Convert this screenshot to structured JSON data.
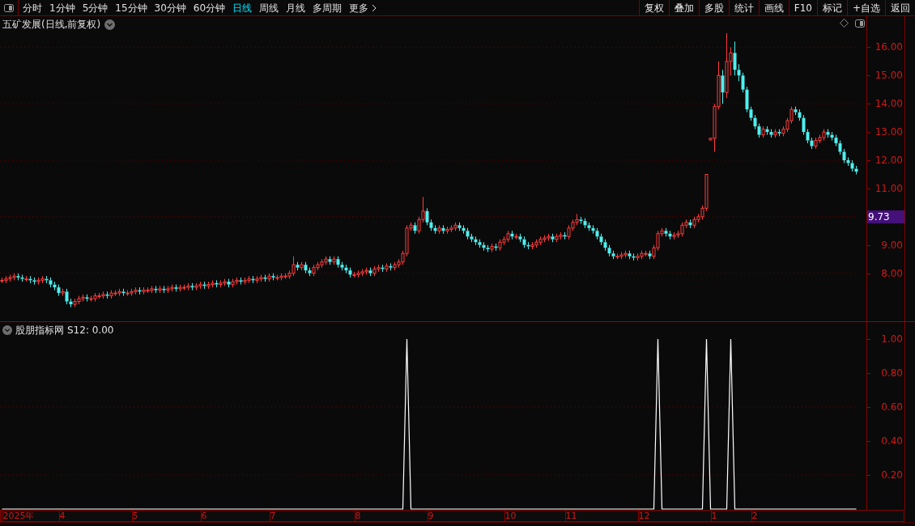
{
  "toolbar": {
    "periods": [
      {
        "label": "分时",
        "selected": false
      },
      {
        "label": "1分钟",
        "selected": false
      },
      {
        "label": "5分钟",
        "selected": false
      },
      {
        "label": "15分钟",
        "selected": false
      },
      {
        "label": "30分钟",
        "selected": false
      },
      {
        "label": "60分钟",
        "selected": false
      },
      {
        "label": "日线",
        "selected": true
      },
      {
        "label": "周线",
        "selected": false
      },
      {
        "label": "月线",
        "selected": false
      },
      {
        "label": "多周期",
        "selected": false
      },
      {
        "label": "更多",
        "selected": false
      }
    ],
    "buttons": [
      "复权",
      "叠加",
      "多股",
      "统计",
      "画线",
      "F10",
      "标记",
      "+自选",
      "返回"
    ]
  },
  "price_panel": {
    "title": "五矿发展(日线,前复权)",
    "chart_data": {
      "type": "candlestick",
      "ylim": [
        6.3,
        17.1
      ],
      "yticks": [
        {
          "value": 8,
          "label": "8.00"
        },
        {
          "value": 9,
          "label": "9.00"
        },
        {
          "value": 11,
          "label": "11.00"
        },
        {
          "value": 12,
          "label": "12.00"
        },
        {
          "value": 13,
          "label": "13.00"
        },
        {
          "value": 14,
          "label": "14.00"
        },
        {
          "value": 15,
          "label": "15.00"
        },
        {
          "value": 16,
          "label": "16.00"
        }
      ],
      "annotations": [
        "9.73"
      ],
      "grid": true,
      "ohlc": [
        [
          7.75,
          7.85,
          7.65,
          7.75
        ],
        [
          7.75,
          7.9,
          7.65,
          7.8
        ],
        [
          7.8,
          7.95,
          7.7,
          7.85
        ],
        [
          7.85,
          8.0,
          7.75,
          7.9
        ],
        [
          7.9,
          8.0,
          7.75,
          7.85
        ],
        [
          7.85,
          7.95,
          7.7,
          7.8
        ],
        [
          7.8,
          7.9,
          7.7,
          7.8
        ],
        [
          7.8,
          7.9,
          7.65,
          7.75
        ],
        [
          7.75,
          7.85,
          7.6,
          7.7
        ],
        [
          7.7,
          7.85,
          7.6,
          7.75
        ],
        [
          7.75,
          7.9,
          7.65,
          7.8
        ],
        [
          7.8,
          7.9,
          7.65,
          7.75
        ],
        [
          7.75,
          7.85,
          7.5,
          7.6
        ],
        [
          7.6,
          7.7,
          7.4,
          7.5
        ],
        [
          7.5,
          7.6,
          7.2,
          7.3
        ],
        [
          7.3,
          7.45,
          7.2,
          7.35
        ],
        [
          7.35,
          7.45,
          6.9,
          7.0
        ],
        [
          7.0,
          7.1,
          6.8,
          6.9
        ],
        [
          6.9,
          7.1,
          6.8,
          7.0
        ],
        [
          7.0,
          7.2,
          6.9,
          7.1
        ],
        [
          7.1,
          7.25,
          7.0,
          7.15
        ],
        [
          7.15,
          7.25,
          7.0,
          7.1
        ],
        [
          7.1,
          7.2,
          7.0,
          7.1
        ],
        [
          7.1,
          7.3,
          7.0,
          7.2
        ],
        [
          7.2,
          7.3,
          7.1,
          7.2
        ],
        [
          7.2,
          7.35,
          7.1,
          7.25
        ],
        [
          7.25,
          7.35,
          7.1,
          7.2
        ],
        [
          7.2,
          7.4,
          7.1,
          7.3
        ],
        [
          7.3,
          7.4,
          7.2,
          7.3
        ],
        [
          7.3,
          7.45,
          7.2,
          7.35
        ],
        [
          7.35,
          7.45,
          7.2,
          7.3
        ],
        [
          7.3,
          7.4,
          7.2,
          7.3
        ],
        [
          7.3,
          7.45,
          7.2,
          7.35
        ],
        [
          7.35,
          7.5,
          7.25,
          7.4
        ],
        [
          7.4,
          7.5,
          7.25,
          7.35
        ],
        [
          7.35,
          7.5,
          7.25,
          7.4
        ],
        [
          7.4,
          7.5,
          7.3,
          7.4
        ],
        [
          7.4,
          7.55,
          7.3,
          7.45
        ],
        [
          7.45,
          7.55,
          7.3,
          7.4
        ],
        [
          7.4,
          7.55,
          7.3,
          7.45
        ],
        [
          7.45,
          7.55,
          7.3,
          7.4
        ],
        [
          7.4,
          7.55,
          7.3,
          7.45
        ],
        [
          7.45,
          7.6,
          7.35,
          7.5
        ],
        [
          7.5,
          7.6,
          7.35,
          7.45
        ],
        [
          7.45,
          7.6,
          7.35,
          7.5
        ],
        [
          7.5,
          7.6,
          7.4,
          7.5
        ],
        [
          7.5,
          7.65,
          7.4,
          7.55
        ],
        [
          7.55,
          7.65,
          7.4,
          7.5
        ],
        [
          7.5,
          7.65,
          7.4,
          7.55
        ],
        [
          7.55,
          7.7,
          7.45,
          7.6
        ],
        [
          7.6,
          7.7,
          7.45,
          7.55
        ],
        [
          7.55,
          7.7,
          7.45,
          7.6
        ],
        [
          7.6,
          7.75,
          7.5,
          7.65
        ],
        [
          7.65,
          7.75,
          7.5,
          7.6
        ],
        [
          7.6,
          7.75,
          7.5,
          7.65
        ],
        [
          7.65,
          7.8,
          7.55,
          7.7
        ],
        [
          7.7,
          7.8,
          7.5,
          7.6
        ],
        [
          7.6,
          7.8,
          7.5,
          7.7
        ],
        [
          7.7,
          7.85,
          7.6,
          7.75
        ],
        [
          7.75,
          7.85,
          7.6,
          7.7
        ],
        [
          7.7,
          7.85,
          7.6,
          7.75
        ],
        [
          7.75,
          7.9,
          7.65,
          7.8
        ],
        [
          7.8,
          7.9,
          7.65,
          7.75
        ],
        [
          7.75,
          7.9,
          7.65,
          7.8
        ],
        [
          7.8,
          7.95,
          7.7,
          7.85
        ],
        [
          7.85,
          7.95,
          7.7,
          7.8
        ],
        [
          7.8,
          8.0,
          7.7,
          7.9
        ],
        [
          7.9,
          8.0,
          7.75,
          7.85
        ],
        [
          7.85,
          7.95,
          7.75,
          7.85
        ],
        [
          7.85,
          8.0,
          7.75,
          7.9
        ],
        [
          7.9,
          8.0,
          7.8,
          7.9
        ],
        [
          7.9,
          8.1,
          7.8,
          8.0
        ],
        [
          8.0,
          8.6,
          7.9,
          8.3
        ],
        [
          8.3,
          8.4,
          8.1,
          8.2
        ],
        [
          8.2,
          8.4,
          8.1,
          8.3
        ],
        [
          8.3,
          8.4,
          8.0,
          8.1
        ],
        [
          8.1,
          8.2,
          7.9,
          8.0
        ],
        [
          8.0,
          8.3,
          7.9,
          8.2
        ],
        [
          8.2,
          8.4,
          8.1,
          8.3
        ],
        [
          8.3,
          8.5,
          8.2,
          8.4
        ],
        [
          8.4,
          8.6,
          8.3,
          8.5
        ],
        [
          8.5,
          8.6,
          8.3,
          8.4
        ],
        [
          8.4,
          8.6,
          8.3,
          8.5
        ],
        [
          8.5,
          8.6,
          8.2,
          8.3
        ],
        [
          8.3,
          8.4,
          8.1,
          8.2
        ],
        [
          8.2,
          8.3,
          8.0,
          8.1
        ],
        [
          8.1,
          8.2,
          7.85,
          7.95
        ],
        [
          7.95,
          8.05,
          7.85,
          7.95
        ],
        [
          7.95,
          8.1,
          7.85,
          8.0
        ],
        [
          8.0,
          8.15,
          7.9,
          8.05
        ],
        [
          8.05,
          8.2,
          7.95,
          8.1
        ],
        [
          8.1,
          8.2,
          7.9,
          8.0
        ],
        [
          8.0,
          8.25,
          7.9,
          8.15
        ],
        [
          8.15,
          8.3,
          8.05,
          8.2
        ],
        [
          8.2,
          8.3,
          8.05,
          8.15
        ],
        [
          8.15,
          8.35,
          8.05,
          8.25
        ],
        [
          8.25,
          8.35,
          8.1,
          8.2
        ],
        [
          8.2,
          8.4,
          8.1,
          8.3
        ],
        [
          8.3,
          8.5,
          8.2,
          8.4
        ],
        [
          8.4,
          8.8,
          8.3,
          8.7
        ],
        [
          8.7,
          9.7,
          8.6,
          9.6
        ],
        [
          9.6,
          9.8,
          9.5,
          9.7
        ],
        [
          9.7,
          9.8,
          9.4,
          9.5
        ],
        [
          9.5,
          10.0,
          9.4,
          9.9
        ],
        [
          9.9,
          10.7,
          9.8,
          10.2
        ],
        [
          10.2,
          10.3,
          9.7,
          9.8
        ],
        [
          9.8,
          9.9,
          9.5,
          9.6
        ],
        [
          9.6,
          9.7,
          9.4,
          9.5
        ],
        [
          9.5,
          9.7,
          9.4,
          9.6
        ],
        [
          9.6,
          9.7,
          9.4,
          9.5
        ],
        [
          9.5,
          9.65,
          9.4,
          9.55
        ],
        [
          9.55,
          9.7,
          9.45,
          9.6
        ],
        [
          9.6,
          9.8,
          9.5,
          9.7
        ],
        [
          9.7,
          9.8,
          9.5,
          9.6
        ],
        [
          9.6,
          9.7,
          9.4,
          9.5
        ],
        [
          9.5,
          9.6,
          9.2,
          9.3
        ],
        [
          9.3,
          9.4,
          9.1,
          9.2
        ],
        [
          9.2,
          9.3,
          9.0,
          9.1
        ],
        [
          9.1,
          9.2,
          8.9,
          9.0
        ],
        [
          9.0,
          9.1,
          8.8,
          8.9
        ],
        [
          8.9,
          9.0,
          8.75,
          8.85
        ],
        [
          8.85,
          9.05,
          8.75,
          8.95
        ],
        [
          8.95,
          9.05,
          8.8,
          8.9
        ],
        [
          8.9,
          9.2,
          8.8,
          9.1
        ],
        [
          9.1,
          9.3,
          9.0,
          9.2
        ],
        [
          9.2,
          9.5,
          9.1,
          9.4
        ],
        [
          9.4,
          9.5,
          9.2,
          9.3
        ],
        [
          9.3,
          9.4,
          9.2,
          9.3
        ],
        [
          9.3,
          9.4,
          9.1,
          9.2
        ],
        [
          9.2,
          9.3,
          8.9,
          9.0
        ],
        [
          9.0,
          9.1,
          8.85,
          8.95
        ],
        [
          8.95,
          9.1,
          8.85,
          9.0
        ],
        [
          9.0,
          9.2,
          8.9,
          9.1
        ],
        [
          9.1,
          9.3,
          9.0,
          9.2
        ],
        [
          9.2,
          9.35,
          9.1,
          9.25
        ],
        [
          9.25,
          9.4,
          9.15,
          9.3
        ],
        [
          9.3,
          9.4,
          9.1,
          9.2
        ],
        [
          9.2,
          9.4,
          9.1,
          9.3
        ],
        [
          9.3,
          9.45,
          9.2,
          9.35
        ],
        [
          9.35,
          9.45,
          9.2,
          9.3
        ],
        [
          9.3,
          9.7,
          9.2,
          9.6
        ],
        [
          9.6,
          9.9,
          9.5,
          9.8
        ],
        [
          9.8,
          10.1,
          9.7,
          9.9
        ],
        [
          9.9,
          10.0,
          9.75,
          9.85
        ],
        [
          9.85,
          9.95,
          9.6,
          9.7
        ],
        [
          9.7,
          9.8,
          9.5,
          9.6
        ],
        [
          9.6,
          9.7,
          9.4,
          9.5
        ],
        [
          9.5,
          9.6,
          9.2,
          9.3
        ],
        [
          9.3,
          9.4,
          9.0,
          9.1
        ],
        [
          9.1,
          9.2,
          8.8,
          8.9
        ],
        [
          8.9,
          9.0,
          8.6,
          8.7
        ],
        [
          8.7,
          8.8,
          8.5,
          8.6
        ],
        [
          8.6,
          8.7,
          8.5,
          8.6
        ],
        [
          8.6,
          8.75,
          8.5,
          8.65
        ],
        [
          8.65,
          8.8,
          8.55,
          8.7
        ],
        [
          8.7,
          8.8,
          8.5,
          8.6
        ],
        [
          8.6,
          8.7,
          8.45,
          8.55
        ],
        [
          8.55,
          8.7,
          8.45,
          8.6
        ],
        [
          8.6,
          8.8,
          8.5,
          8.7
        ],
        [
          8.7,
          8.8,
          8.6,
          8.7
        ],
        [
          8.7,
          8.8,
          8.5,
          8.6
        ],
        [
          8.6,
          9.0,
          8.5,
          8.9
        ],
        [
          8.9,
          9.5,
          8.8,
          9.4
        ],
        [
          9.4,
          9.6,
          9.3,
          9.5
        ],
        [
          9.5,
          9.6,
          9.3,
          9.4
        ],
        [
          9.4,
          9.5,
          9.2,
          9.3
        ],
        [
          9.3,
          9.45,
          9.2,
          9.35
        ],
        [
          9.35,
          9.5,
          9.25,
          9.4
        ],
        [
          9.4,
          9.8,
          9.3,
          9.7
        ],
        [
          9.7,
          9.9,
          9.6,
          9.8
        ],
        [
          9.8,
          9.9,
          9.6,
          9.7
        ],
        [
          9.7,
          10.0,
          9.6,
          9.9
        ],
        [
          9.9,
          10.1,
          9.8,
          10.0
        ],
        [
          10.0,
          10.4,
          9.9,
          10.3
        ],
        [
          10.3,
          11.5,
          10.2,
          11.5
        ],
        [
          12.72,
          12.8,
          12.7,
          12.78
        ],
        [
          12.78,
          14.0,
          12.3,
          13.9
        ],
        [
          13.9,
          15.5,
          13.8,
          15.0
        ],
        [
          15.0,
          15.2,
          14.0,
          14.4
        ],
        [
          14.4,
          16.5,
          14.2,
          15.5
        ],
        [
          15.5,
          16.0,
          15.0,
          15.8
        ],
        [
          15.8,
          16.2,
          15.0,
          15.2
        ],
        [
          15.2,
          15.4,
          14.8,
          15.0
        ],
        [
          15.0,
          15.1,
          14.4,
          14.5
        ],
        [
          14.5,
          14.6,
          13.7,
          13.8
        ],
        [
          13.8,
          13.9,
          13.4,
          13.5
        ],
        [
          13.5,
          13.6,
          13.1,
          13.2
        ],
        [
          13.2,
          13.3,
          12.8,
          12.9
        ],
        [
          12.9,
          13.2,
          12.8,
          13.1
        ],
        [
          13.1,
          13.2,
          12.9,
          13.0
        ],
        [
          13.0,
          13.1,
          12.8,
          12.9
        ],
        [
          12.9,
          13.1,
          12.8,
          13.0
        ],
        [
          13.0,
          13.1,
          12.85,
          12.95
        ],
        [
          12.95,
          13.2,
          12.85,
          13.1
        ],
        [
          13.1,
          13.5,
          13.0,
          13.4
        ],
        [
          13.4,
          13.9,
          13.3,
          13.8
        ],
        [
          13.8,
          13.9,
          13.6,
          13.7
        ],
        [
          13.7,
          13.8,
          13.4,
          13.5
        ],
        [
          13.5,
          13.6,
          12.9,
          13.0
        ],
        [
          13.0,
          13.1,
          12.6,
          12.7
        ],
        [
          12.7,
          12.8,
          12.4,
          12.5
        ],
        [
          12.5,
          12.8,
          12.4,
          12.7
        ],
        [
          12.7,
          12.9,
          12.6,
          12.8
        ],
        [
          12.8,
          13.1,
          12.7,
          13.0
        ],
        [
          13.0,
          13.1,
          12.8,
          12.9
        ],
        [
          12.9,
          13.0,
          12.7,
          12.8
        ],
        [
          12.8,
          12.9,
          12.5,
          12.6
        ],
        [
          12.6,
          12.7,
          12.2,
          12.3
        ],
        [
          12.3,
          12.4,
          11.9,
          12.0
        ],
        [
          12.0,
          12.1,
          11.8,
          11.9
        ],
        [
          11.9,
          12.0,
          11.6,
          11.7
        ],
        [
          11.7,
          11.8,
          11.5,
          11.6
        ]
      ]
    }
  },
  "indicator_panel": {
    "name": "股朋指标网",
    "reading": "S12: 0.00",
    "chart_data": {
      "type": "line",
      "ylim": [
        0,
        1.1
      ],
      "grid": true,
      "yticks": [
        {
          "value": 0.2,
          "label": "0.20"
        },
        {
          "value": 0.4,
          "label": "0.40"
        },
        {
          "value": 0.6,
          "label": "0.60"
        },
        {
          "value": 0.8,
          "label": "0.80"
        },
        {
          "value": 1,
          "label": "1.00"
        }
      ],
      "values": [
        0,
        0,
        0,
        0,
        0,
        0,
        0,
        0,
        0,
        0,
        0,
        0,
        0,
        0,
        0,
        0,
        0,
        0,
        0,
        0,
        0,
        0,
        0,
        0,
        0,
        0,
        0,
        0,
        0,
        0,
        0,
        0,
        0,
        0,
        0,
        0,
        0,
        0,
        0,
        0,
        0,
        0,
        0,
        0,
        0,
        0,
        0,
        0,
        0,
        0,
        0,
        0,
        0,
        0,
        0,
        0,
        0,
        0,
        0,
        0,
        0,
        0,
        0,
        0,
        0,
        0,
        0,
        0,
        0,
        0,
        0,
        0,
        0,
        0,
        0,
        0,
        0,
        0,
        0,
        0,
        0,
        0,
        0,
        0,
        0,
        0,
        0,
        0,
        0,
        0,
        0,
        0,
        0,
        0,
        0,
        0,
        0,
        0,
        0,
        0,
        1,
        0,
        0,
        0,
        0,
        0,
        0,
        0,
        0,
        0,
        0,
        0,
        0,
        0,
        0,
        0,
        0,
        0,
        0,
        0,
        0,
        0,
        0,
        0,
        0,
        0,
        0,
        0,
        0,
        0,
        0,
        0,
        0,
        0,
        0,
        0,
        0,
        0,
        0,
        0,
        0,
        0,
        0,
        0,
        0,
        0,
        0,
        0,
        0,
        0,
        0,
        0,
        0,
        0,
        0,
        0,
        0,
        0,
        0,
        0,
        0,
        0,
        1,
        0,
        0,
        0,
        0,
        0,
        0,
        0,
        0,
        0,
        0,
        0,
        1,
        0,
        0,
        0,
        0,
        0,
        1,
        0,
        0,
        0,
        0,
        0,
        0,
        0,
        0,
        0,
        0,
        0,
        0,
        0,
        0,
        0,
        0,
        0,
        0,
        0,
        0,
        0,
        0,
        0,
        0,
        0,
        0,
        0,
        0,
        0,
        0,
        0
      ]
    }
  },
  "time_axis": [
    "2025年",
    "4",
    "5",
    "6",
    "7",
    "8",
    "9",
    "10",
    "11",
    "12",
    "1",
    "2"
  ]
}
